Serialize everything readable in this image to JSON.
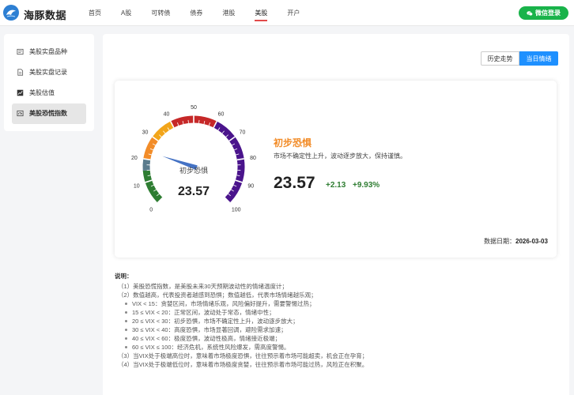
{
  "app": {
    "name": "海豚数据"
  },
  "nav": [
    {
      "label": "首页",
      "active": false
    },
    {
      "label": "A股",
      "active": false
    },
    {
      "label": "可转债",
      "active": false
    },
    {
      "label": "债券",
      "active": false
    },
    {
      "label": "港股",
      "active": false
    },
    {
      "label": "美股",
      "active": true
    },
    {
      "label": "开户",
      "active": false
    }
  ],
  "login": {
    "label": "微信登录"
  },
  "sidebar": [
    {
      "label": "美股实盘品种",
      "icon": "list-icon",
      "active": false
    },
    {
      "label": "美股实盘记录",
      "icon": "document-icon",
      "active": false
    },
    {
      "label": "美股估值",
      "icon": "chart-icon",
      "active": false
    },
    {
      "label": "美股恐慌指数",
      "icon": "gauge-icon",
      "active": true
    }
  ],
  "switch": {
    "history": "历史走势",
    "today": "当日情绪",
    "active": "today"
  },
  "gauge": {
    "min": 0,
    "max": 100,
    "value": 23.57,
    "ticks": [
      "0",
      "10",
      "20",
      "30",
      "40",
      "50",
      "60",
      "70",
      "80",
      "90",
      "100"
    ],
    "center_label": "初步恐惧",
    "center_value": "23.57",
    "bands": [
      {
        "from": 0,
        "to": 15,
        "color": "#2e7d32"
      },
      {
        "from": 15,
        "to": 20,
        "color": "#5b7c8d"
      },
      {
        "from": 20,
        "to": 30,
        "color": "#f28c28"
      },
      {
        "from": 30,
        "to": 40,
        "color": "#f2a51a"
      },
      {
        "from": 40,
        "to": 60,
        "color": "#c62828"
      },
      {
        "from": 60,
        "to": 100,
        "color": "#4a148c"
      }
    ],
    "needle_color": "#4472c4"
  },
  "summary": {
    "title": "初步恐惧",
    "title_color": "#f28c28",
    "desc": "市场不确定性上升，波动逐步放大，保持谨慎。",
    "value": "23.57",
    "change": "+2.13",
    "change_pct": "+9.93%",
    "change_color": "#2f7d32",
    "date_label": "数据日期：",
    "date": "2026-03-03"
  },
  "notes": {
    "title": "说明：",
    "lines": [
      "（1）美股恐慌指数，是美股未来30天预期波动性的情绪温度计；",
      "（2）数值越高，代表投资者越感到恐惧；数值越低，代表市场情绪越乐观；"
    ],
    "bullets": [
      "VIX < 15：贪婪区间，市场情绪乐观，风险偏好提升，需要警惕过热；",
      "15 ≤ VIX < 20：正常区间，波动处于常态，情绪中性；",
      "20 ≤ VIX < 30：初步恐惧，市场不确定性上升，波动逐步放大；",
      "30 ≤ VIX < 40：高度恐惧，市场显著回调，避险需求加速；",
      "40 ≤ VIX < 60：极度恐惧，波动性极高，情绪接近极端；",
      "60 ≤ VIX ≤ 100：经济危机，系统性风险爆发，需高度警惕。"
    ],
    "tail": [
      "（3）当VIX处于极端高位时，意味着市场极度恐惧，往往预示着市场可能超卖，机会正在孕育；",
      "（4）当VIX处于极端低位时，意味着市场极度贪婪，往往预示着市场可能过热，风险正在积聚。"
    ]
  }
}
